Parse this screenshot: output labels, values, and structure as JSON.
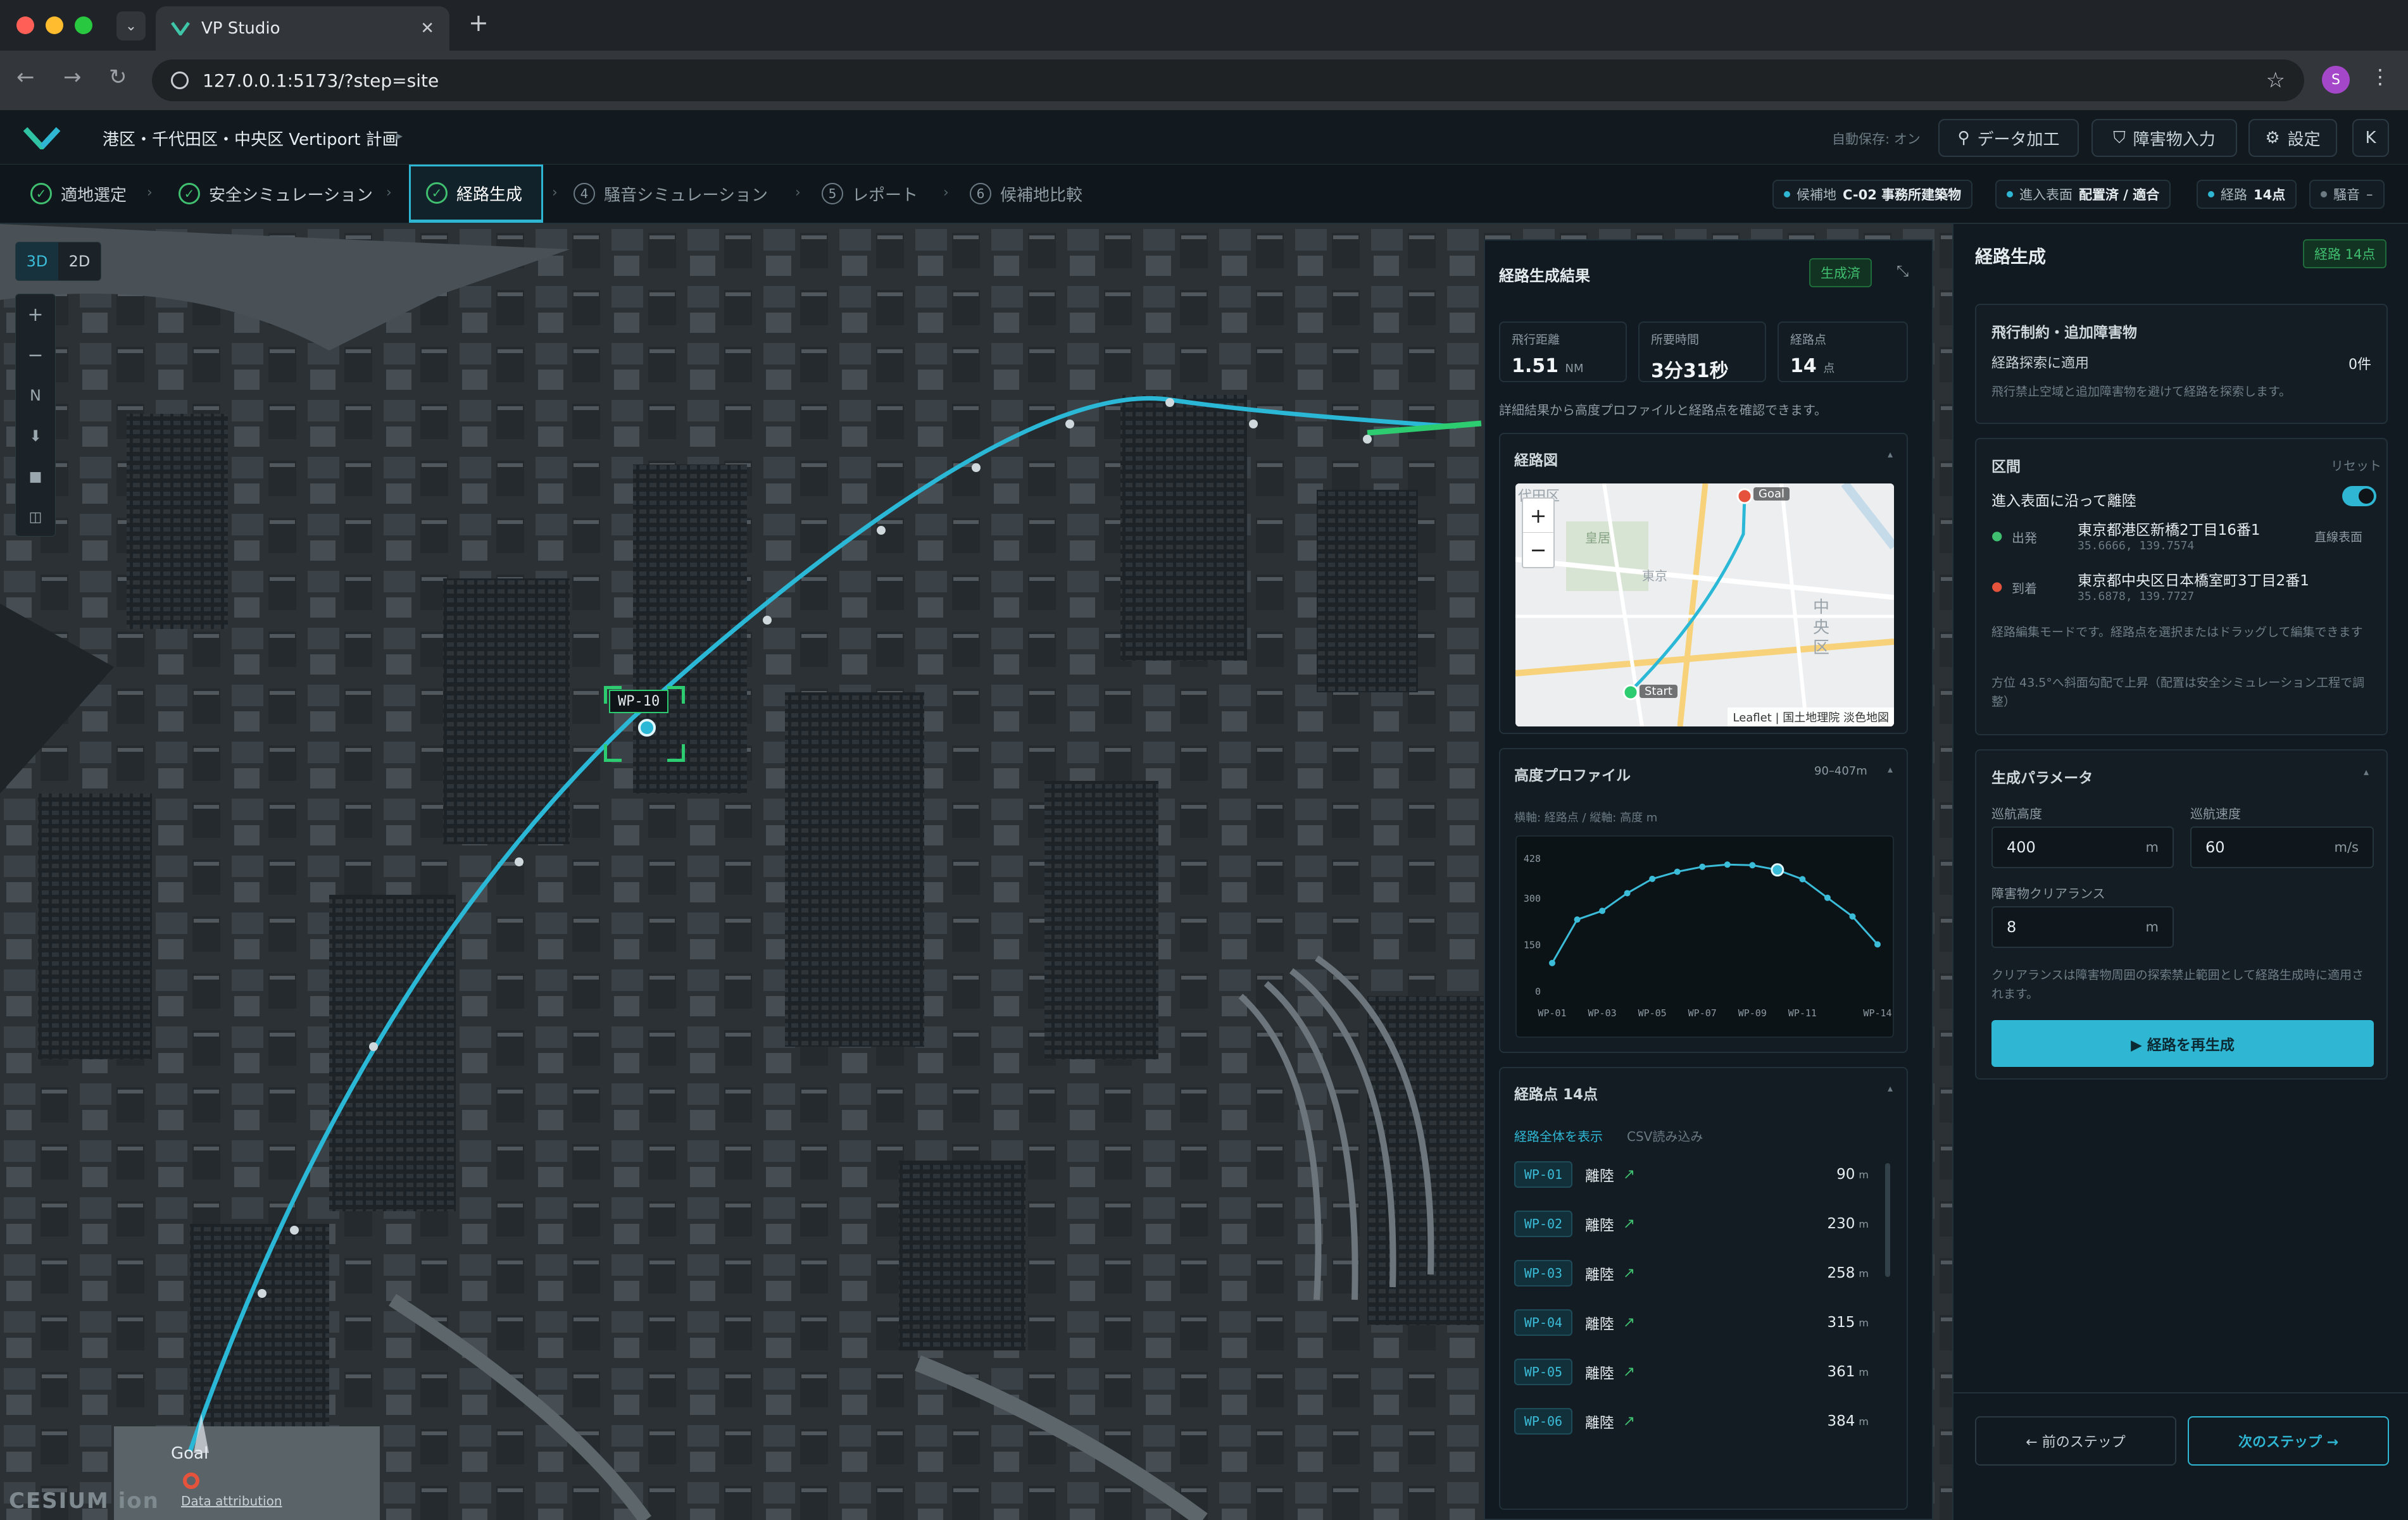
{
  "browser": {
    "tab_title": "VP Studio",
    "url": "127.0.0.1:5173/?step=site",
    "profile_initial": "S"
  },
  "app": {
    "project_title": "港区・千代田区・中央区 Vertiport 計画",
    "autosave": "自動保存: オン",
    "btn_data": "データ加工",
    "btn_obstacle": "障害物入力",
    "btn_settings": "設定",
    "user_initial": "K"
  },
  "steps": [
    {
      "label": "適地選定",
      "state": "done"
    },
    {
      "label": "安全シミュレーション",
      "state": "done"
    },
    {
      "label": "経路生成",
      "state": "active"
    },
    {
      "num": "4",
      "label": "騒音シミュレーション",
      "state": "pending"
    },
    {
      "num": "5",
      "label": "レポート",
      "state": "pending"
    },
    {
      "num": "6",
      "label": "候補地比較",
      "state": "pending"
    }
  ],
  "chips": {
    "candidate_label": "候補地",
    "candidate_value": "C-02 事務所建築物",
    "approach_label": "進入表面",
    "approach_value": "配置済 / 適合",
    "route_label": "経路",
    "route_value": "14点",
    "noise_label": "騒音",
    "noise_value": "–"
  },
  "map": {
    "btn_3d": "3D",
    "btn_2d": "2D",
    "ctl_zoom_in": "+",
    "ctl_zoom_out": "−",
    "ctl_north": "N",
    "wp_label": "WP-10",
    "goal_label": "Goal",
    "cesium_logo": "CESIUM ion",
    "attribution": "Data attribution"
  },
  "results": {
    "title": "経路生成結果",
    "badge": "生成済",
    "kpi": [
      {
        "label": "飛行距離",
        "value": "1.51",
        "unit": "NM"
      },
      {
        "label": "所要時間",
        "value": "3分31秒",
        "unit": ""
      },
      {
        "label": "経路点",
        "value": "14",
        "unit": "点"
      }
    ],
    "hint": "詳細結果から高度プロファイルと経路点を確認できます。",
    "route_map_title": "経路図",
    "minimap": {
      "goal": "Goal",
      "start": "Start",
      "attribution": "Leaflet | 国土地理院 淡色地図",
      "ward": "中央区",
      "zoom_in": "+",
      "zoom_out": "−",
      "label_chiyoda": "代田区",
      "label_kokyo": "皇居",
      "label_tokyo": "東京"
    },
    "altitude_title": "高度プロファイル",
    "altitude_range": "90–407m",
    "altitude_axes": "横軸: 経路点 / 縦軸: 高度 m",
    "waypoints_title": "経路点 14点",
    "wp_link_all": "経路全体を表示",
    "wp_link_csv": "CSV読み込み",
    "waypoints": [
      {
        "id": "WP-01",
        "type": "離陸",
        "alt": "90"
      },
      {
        "id": "WP-02",
        "type": "離陸",
        "alt": "230"
      },
      {
        "id": "WP-03",
        "type": "離陸",
        "alt": "258"
      },
      {
        "id": "WP-04",
        "type": "離陸",
        "alt": "315"
      },
      {
        "id": "WP-05",
        "type": "離陸",
        "alt": "361"
      },
      {
        "id": "WP-06",
        "type": "離陸",
        "alt": "384"
      }
    ],
    "alt_unit": "m"
  },
  "chart_data": {
    "type": "line",
    "title": "高度プロファイル",
    "xlabel": "経路点",
    "ylabel": "高度 m",
    "x": [
      "WP-01",
      "WP-02",
      "WP-03",
      "WP-04",
      "WP-05",
      "WP-06",
      "WP-07",
      "WP-08",
      "WP-09",
      "WP-10",
      "WP-11",
      "WP-12",
      "WP-13",
      "WP-14"
    ],
    "y_ticks": [
      "0",
      "150",
      "300",
      "428"
    ],
    "x_tick_labels": [
      "WP-01",
      "WP-03",
      "WP-05",
      "WP-07",
      "WP-09",
      "WP-11",
      "WP-14"
    ],
    "ylim": [
      0,
      428
    ],
    "series": [
      {
        "values": [
          90,
          230,
          258,
          315,
          361,
          384,
          400,
          407,
          405,
          390,
          360,
          300,
          240,
          150
        ]
      }
    ],
    "highlight_index": 9,
    "color": "#3bbcd8"
  },
  "side": {
    "title": "経路生成",
    "badge": "経路 14点",
    "restrictions_title": "飛行制約・追加障害物",
    "restrictions_label": "経路探索に適用",
    "restrictions_count": "0件",
    "restrictions_desc": "飛行禁止空域と追加障害物を避けて経路を探索します。",
    "segment_title": "区間",
    "segment_reset": "リセット",
    "segment_toggle_label": "進入表面に沿って離陸",
    "departure_label": "出発",
    "departure_addr": "東京都港区新橋2丁目16番1",
    "departure_coords": "35.6666, 139.7574",
    "departure_mode": "直線表面",
    "arrival_label": "到着",
    "arrival_addr": "東京都中央区日本橋室町3丁目2番1",
    "arrival_coords": "35.6878, 139.7727",
    "edit_note": "経路編集モードです。経路点を選択またはドラッグして編集できます",
    "heading_note": "方位 43.5°へ斜面勾配で上昇（配置は安全シミュレーション工程で調整）",
    "params_title": "生成パラメータ",
    "cruise_alt_label": "巡航高度",
    "cruise_alt_value": "400",
    "cruise_alt_unit": "m",
    "cruise_speed_label": "巡航速度",
    "cruise_speed_value": "60",
    "cruise_speed_unit": "m/s",
    "clearance_label": "障害物クリアランス",
    "clearance_value": "8",
    "clearance_unit": "m",
    "clearance_note": "クリアランスは障害物周囲の探索禁止範囲として経路生成時に適用されます。",
    "regen_btn": "▶ 経路を再生成",
    "prev_btn": "← 前のステップ",
    "next_btn": "次のステップ →"
  },
  "colors": {
    "accent": "#2fb6d3",
    "success": "#3fbf6f",
    "danger": "#e5533d"
  }
}
